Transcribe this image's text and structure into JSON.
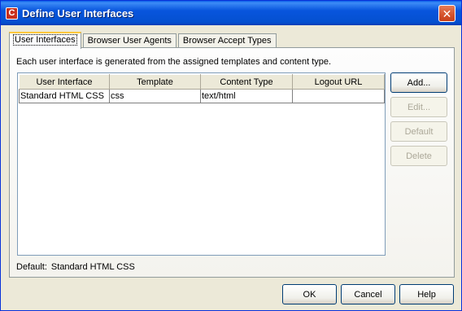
{
  "window": {
    "title": "Define User Interfaces",
    "app_icon_letter": "C",
    "close_glyph": "✕"
  },
  "tabs": [
    {
      "label": "User Interfaces",
      "active": true
    },
    {
      "label": "Browser User Agents",
      "active": false
    },
    {
      "label": "Browser Accept Types",
      "active": false
    }
  ],
  "panel": {
    "description": "Each user interface is generated from the assigned templates and content type.",
    "table": {
      "headers": [
        "User Interface",
        "Template",
        "Content Type",
        "Logout URL"
      ],
      "rows": [
        [
          "Standard HTML CSS",
          "css",
          "text/html",
          ""
        ]
      ]
    },
    "buttons": {
      "add": "Add...",
      "edit": "Edit...",
      "default": "Default",
      "delete": "Delete"
    },
    "default_label": "Default:",
    "default_value": "Standard HTML CSS"
  },
  "footer": {
    "ok": "OK",
    "cancel": "Cancel",
    "help": "Help"
  },
  "colors": {
    "titlebar": "#0855dd",
    "dialog_bg": "#ece9d8",
    "active_tab_highlight": "#ffc83c",
    "close_button": "#d5532c"
  }
}
